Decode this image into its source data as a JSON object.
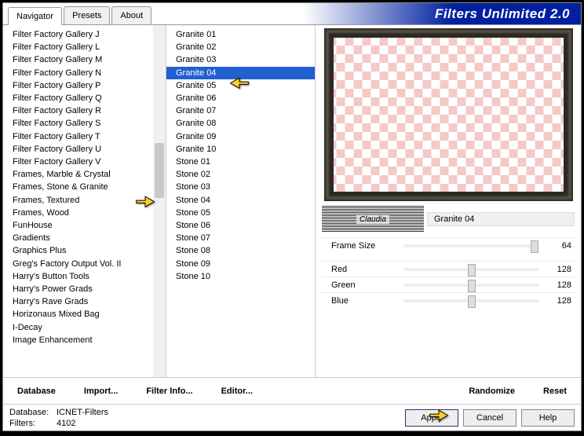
{
  "app_title": "Filters Unlimited 2.0",
  "tabs": {
    "navigator": "Navigator",
    "presets": "Presets",
    "about": "About"
  },
  "categories": [
    "Filter Factory Gallery J",
    "Filter Factory Gallery L",
    "Filter Factory Gallery M",
    "Filter Factory Gallery N",
    "Filter Factory Gallery P",
    "Filter Factory Gallery Q",
    "Filter Factory Gallery R",
    "Filter Factory Gallery S",
    "Filter Factory Gallery T",
    "Filter Factory Gallery U",
    "Filter Factory Gallery V",
    "Frames, Marble & Crystal",
    "Frames, Stone & Granite",
    "Frames, Textured",
    "Frames, Wood",
    "FunHouse",
    "Gradients",
    "Graphics Plus",
    "Greg's Factory Output Vol. II",
    "Harry's Button Tools",
    "Harry's Power Grads",
    "Harry's Rave Grads",
    "Horizonaus Mixed Bag",
    "I-Decay",
    "Image Enhancement"
  ],
  "selected_category_index": 12,
  "filters": [
    "Granite 01",
    "Granite 02",
    "Granite 03",
    "Granite 04",
    "Granite 05",
    "Granite 06",
    "Granite 07",
    "Granite 08",
    "Granite 09",
    "Granite 10",
    "Stone 01",
    "Stone 02",
    "Stone 03",
    "Stone 04",
    "Stone 05",
    "Stone 06",
    "Stone 07",
    "Stone 08",
    "Stone 09",
    "Stone 10"
  ],
  "selected_filter_index": 3,
  "watermark": "Claudia",
  "current_filter_name": "Granite 04",
  "params": {
    "frame_size": {
      "label": "Frame Size",
      "value": "64"
    },
    "red": {
      "label": "Red",
      "value": "128"
    },
    "green": {
      "label": "Green",
      "value": "128"
    },
    "blue": {
      "label": "Blue",
      "value": "128"
    }
  },
  "bottom_buttons": {
    "database": "Database",
    "import": "Import...",
    "filter_info": "Filter Info...",
    "editor": "Editor...",
    "randomize": "Randomize",
    "reset": "Reset"
  },
  "status": {
    "db_label": "Database:",
    "db_value": "ICNET-Filters",
    "filters_label": "Filters:",
    "filters_value": "4102"
  },
  "action_buttons": {
    "apply": "Apply",
    "cancel": "Cancel",
    "help": "Help"
  }
}
